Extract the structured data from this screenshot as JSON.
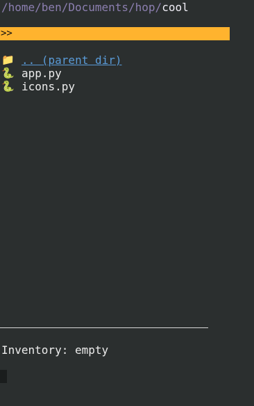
{
  "path": {
    "prefix": "/home/ben/Documents/hop/",
    "current": "cool"
  },
  "prompt": {
    "symbol": ">>"
  },
  "files": [
    {
      "icon": "folder-icon",
      "glyph": "📁",
      "name": ".. (parent dir)",
      "kind": "parent"
    },
    {
      "icon": "snake-icon",
      "glyph": "🐍",
      "name": "app.py",
      "kind": "file"
    },
    {
      "icon": "snake-icon",
      "glyph": "🐍",
      "name": "icons.py",
      "kind": "file"
    }
  ],
  "inventory": {
    "text": "Inventory: empty"
  }
}
